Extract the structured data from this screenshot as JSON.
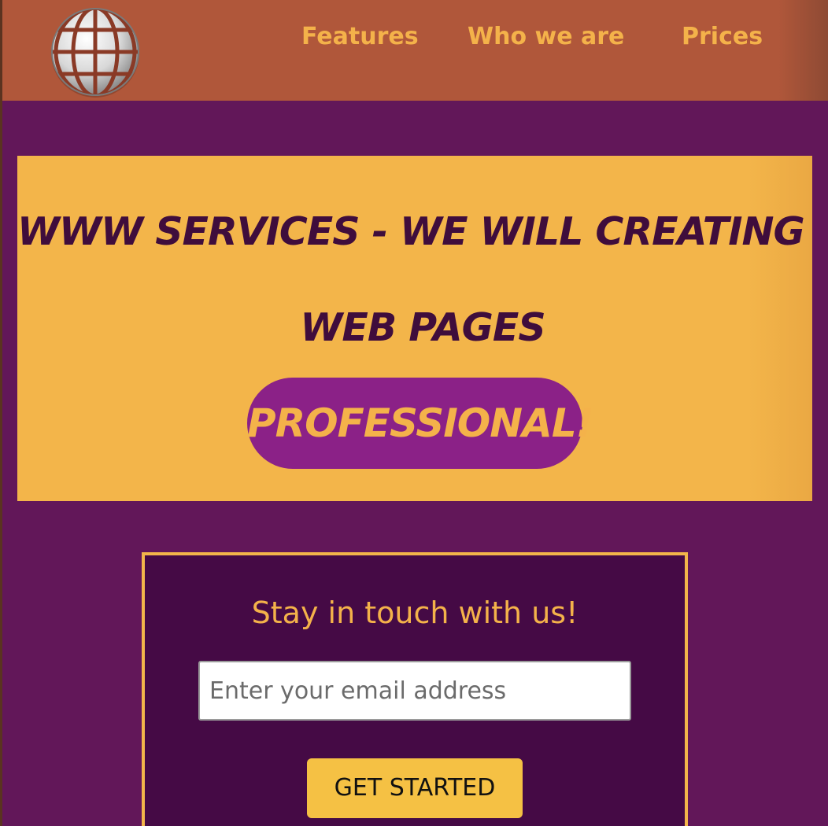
{
  "nav": {
    "items": [
      {
        "label": "Features"
      },
      {
        "label": "Who we are"
      },
      {
        "label": "Prices"
      }
    ]
  },
  "hero": {
    "title_line1": "WWW SERVICES - WE WILL CREATING YOUR",
    "title_line2": "WEB PAGES",
    "badge": "PROFESSIONAL!"
  },
  "signup": {
    "heading": "Stay in touch with us!",
    "email_placeholder": "Enter your email address",
    "button_label": "GET STARTED"
  },
  "colors": {
    "header_bg": "#b0573a",
    "page_bg": "#621759",
    "accent_orange": "#f3b54a",
    "badge_purple": "#8b2187",
    "signup_bg": "#450a45",
    "button_yellow": "#f5c144",
    "title_text": "#3f0d3c"
  },
  "icons": {
    "logo": "globe-icon"
  }
}
